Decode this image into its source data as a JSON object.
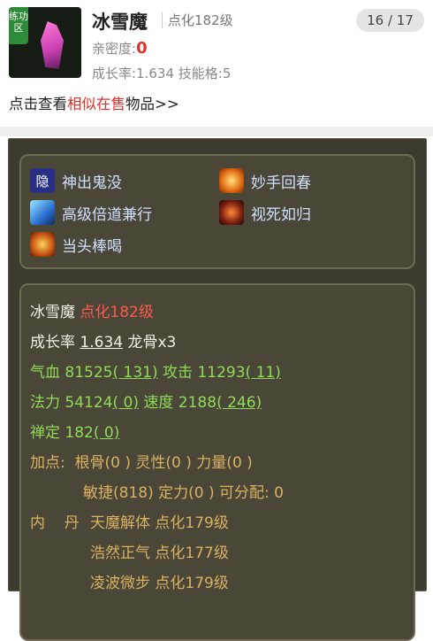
{
  "header": {
    "thumb_tag": "练功区",
    "name": "冰雪魔",
    "level": "点化182级",
    "pager": "16 / 17",
    "intimacy_label": "亲密度:",
    "intimacy_value": "0",
    "growth_text": "成长率:1.634 技能格:5",
    "similar_prefix": "点击查看",
    "similar_link": "相似在售",
    "similar_suffix": "物品>>"
  },
  "skills": [
    {
      "label": "神出鬼没",
      "icon": "ghost-icon",
      "glyph": "隐",
      "color": "#2a2f86"
    },
    {
      "label": "妙手回春",
      "icon": "flame-heal-icon",
      "glyph": "",
      "color": "#e06a12"
    },
    {
      "label": "高级倍道兼行",
      "icon": "wind-speed-icon",
      "glyph": "",
      "color": "#2b6fd0"
    },
    {
      "label": "视死如归",
      "icon": "rage-face-icon",
      "glyph": "",
      "color": "#7a1e10"
    },
    {
      "label": "当头棒喝",
      "icon": "strike-fire-icon",
      "glyph": "",
      "color": "#c65412"
    }
  ],
  "stats": {
    "name": "冰雪魔",
    "level": "点化182级",
    "growth_label": "成长率",
    "growth_value": "1.634",
    "bone": "龙骨x3",
    "hp_label": "气血",
    "hp_value": "81525",
    "hp_bonus": "( 131)",
    "atk_label": "攻击",
    "atk_value": "11293",
    "atk_bonus": "( 11)",
    "mp_label": "法力",
    "mp_value": "54124",
    "mp_bonus": "( 0)",
    "spd_label": "速度",
    "spd_value": "2188",
    "spd_bonus": "( 246)",
    "zen_label": "禅定",
    "zen_value": "182",
    "zen_bonus": "( 0)",
    "points_line1": "加点:  根骨(0 ) 灵性(0 ) 力量(0 )",
    "points_line2": "敏捷(818) 定力(0 ) 可分配:  0",
    "neidan_label": "内    丹",
    "neidan": [
      "天魔解体 点化179级",
      "浩然正气 点化177级",
      "凌波微步 点化179级"
    ]
  }
}
